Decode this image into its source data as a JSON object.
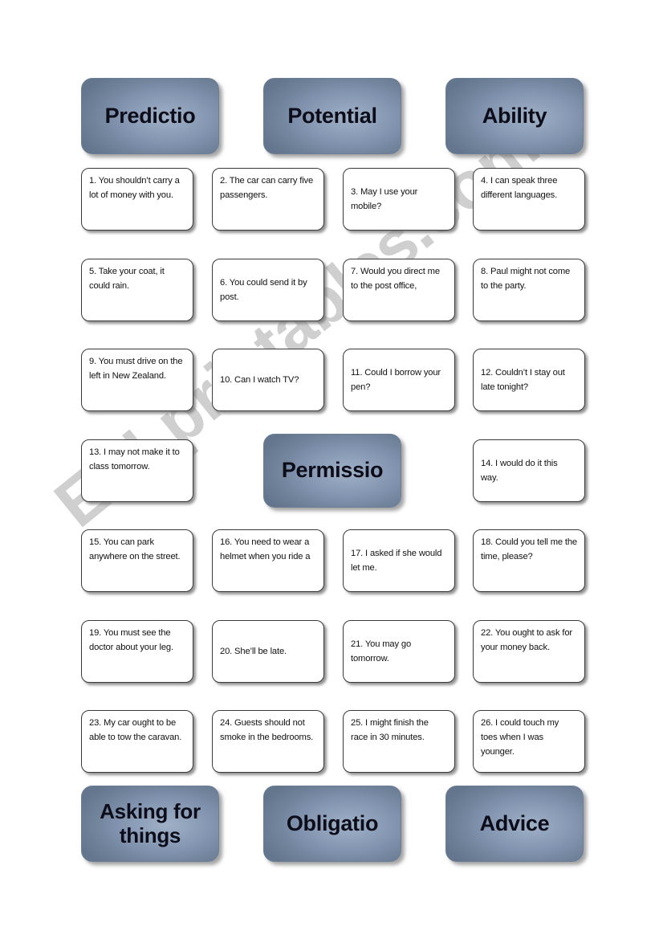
{
  "page": {
    "watermark": "ESLprintables.com",
    "background_color": "#ffffff",
    "card_accent_color": "#7e90ab",
    "card_border_color": "#3a3a3a"
  },
  "top_categories": [
    {
      "label": "Predictio",
      "name": "prediction"
    },
    {
      "label": "Potential",
      "name": "potential"
    },
    {
      "label": "Ability",
      "name": "ability"
    }
  ],
  "middle_category": {
    "label": "Permissio",
    "name": "permission"
  },
  "bottom_categories": [
    {
      "label": "Asking for things",
      "name": "asking-for-things"
    },
    {
      "label": "Obligatio",
      "name": "obligation"
    },
    {
      "label": "Advice",
      "name": "advice"
    }
  ],
  "items": [
    {
      "n": 1,
      "text": "1. You shouldn’t carry a lot of money with you."
    },
    {
      "n": 2,
      "text": "2. The car can carry five passengers."
    },
    {
      "n": 3,
      "text": "3. May I use your mobile?"
    },
    {
      "n": 4,
      "text": "4. I can speak three different languages."
    },
    {
      "n": 5,
      "text": "5. Take your coat, it could rain."
    },
    {
      "n": 6,
      "text": "6. You could send it by post."
    },
    {
      "n": 7,
      "text": "7. Would you direct me to the post office,"
    },
    {
      "n": 8,
      "text": "8. Paul might not come to the party."
    },
    {
      "n": 9,
      "text": "9. You must drive on the left in New Zealand."
    },
    {
      "n": 10,
      "text": "10. Can I watch TV?"
    },
    {
      "n": 11,
      "text": "11. Could I borrow your pen?"
    },
    {
      "n": 12,
      "text": "12. Couldn’t I stay out late tonight?"
    },
    {
      "n": 13,
      "text": "13. I may not make it to class tomorrow."
    },
    {
      "n": 14,
      "text": "14. I would do it this way."
    },
    {
      "n": 15,
      "text": "15. You can park anywhere on the street."
    },
    {
      "n": 16,
      "text": "16. You need to wear a helmet when you ride a"
    },
    {
      "n": 17,
      "text": "17. I asked if she would let me."
    },
    {
      "n": 18,
      "text": "18. Could you tell me the time, please?"
    },
    {
      "n": 19,
      "text": "19. You must see the doctor about your leg."
    },
    {
      "n": 20,
      "text": "20. She’ll be late."
    },
    {
      "n": 21,
      "text": "21. You may go tomorrow."
    },
    {
      "n": 22,
      "text": "22. You ought to ask for your money back."
    },
    {
      "n": 23,
      "text": "23. My car ought to be able to tow the caravan."
    },
    {
      "n": 24,
      "text": "24. Guests should not smoke in the bedrooms."
    },
    {
      "n": 25,
      "text": "25. I might finish the race in 30 minutes."
    },
    {
      "n": 26,
      "text": "26. I could touch my toes when I was younger."
    }
  ]
}
